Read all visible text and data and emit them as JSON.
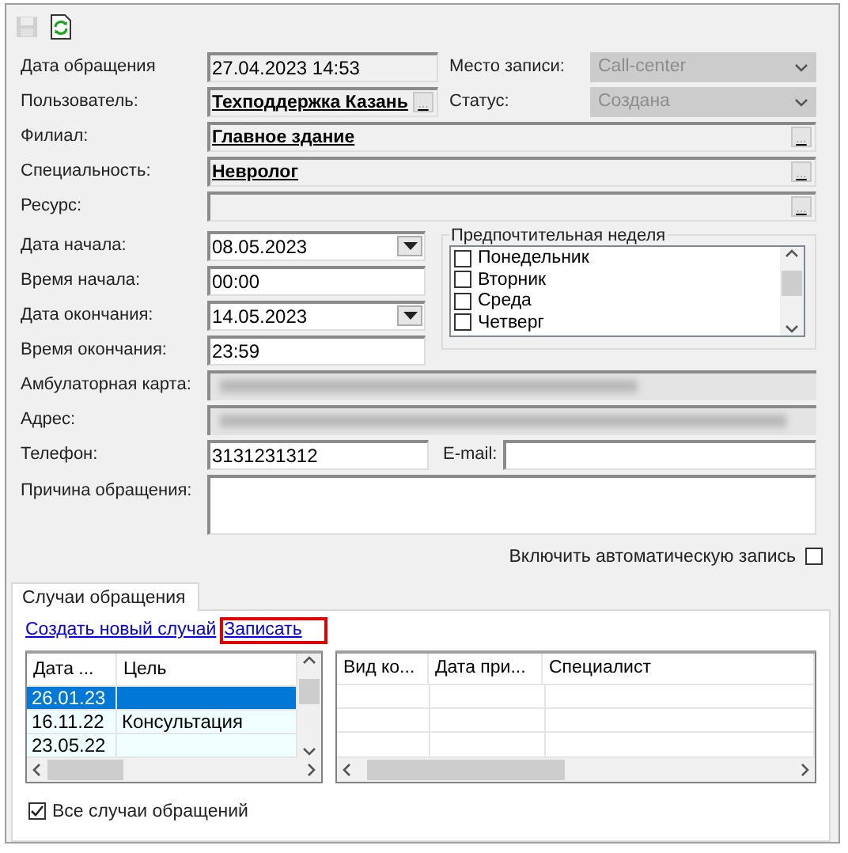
{
  "toolbar": [
    {
      "kind": "save",
      "disabled": true
    },
    {
      "kind": "refresh",
      "disabled": false
    }
  ],
  "request_date": {
    "label": "Дата обращения",
    "value": "27.04.2023 14:53"
  },
  "record_place": {
    "label": "Место записи:",
    "value": "Call-center",
    "disabled": true
  },
  "user": {
    "label": "Пользователь:",
    "value": "Техподдержка Казань",
    "button": "..."
  },
  "status": {
    "label": "Статус:",
    "value": "Создана",
    "disabled": true
  },
  "branch": {
    "label": "Филиал:",
    "value": "Главное здание",
    "button": "..."
  },
  "specialty": {
    "label": "Специальность:",
    "value": "Невролог",
    "button": "..."
  },
  "resource": {
    "label": "Ресурс:",
    "button": "..."
  },
  "start_date": {
    "label": "Дата начала:",
    "value": "08.05.2023"
  },
  "start_time": {
    "label": "Время начала:",
    "value": "00:00"
  },
  "end_date": {
    "label": "Дата окончания:",
    "value": "14.05.2023"
  },
  "end_time": {
    "label": "Время окончания:",
    "value": "23:59"
  },
  "preferred_week": {
    "title": "Предпочтительная неделя",
    "days": [
      {
        "label": "Понедельник",
        "checked": false
      },
      {
        "label": "Вторник",
        "checked": false
      },
      {
        "label": "Среда",
        "checked": false
      },
      {
        "label": "Четверг",
        "checked": false
      }
    ]
  },
  "card": {
    "label": "Амбулаторная карта:"
  },
  "address": {
    "label": "Адрес:"
  },
  "phone": {
    "label": "Телефон:",
    "value": "3131231312"
  },
  "email": {
    "label": "E-mail:"
  },
  "reason": {
    "label": "Причина обращения:"
  },
  "auto_record": {
    "label": "Включить автоматическую запись",
    "checked": false
  },
  "tabs": [
    {
      "label": "Случаи обращения",
      "selected": true
    }
  ],
  "links": [
    {
      "label": "Создать новый случай",
      "highlighted": false
    },
    {
      "label": "Записать",
      "highlighted": true
    }
  ],
  "cases_table": {
    "columns": [
      "Дата ...",
      "Цель"
    ],
    "rows": [
      {
        "date": "26.01.23",
        "selected": true
      },
      {
        "date": "16.11.22",
        "goal": "Консультация",
        "selected": false
      },
      {
        "date": "23.05.22",
        "selected": false
      }
    ]
  },
  "visits_table": {
    "columns": [
      "Вид ко...",
      "Дата при...",
      "Специалист"
    ]
  },
  "all_cases": {
    "label": "Все случаи обращений",
    "checked": true
  }
}
